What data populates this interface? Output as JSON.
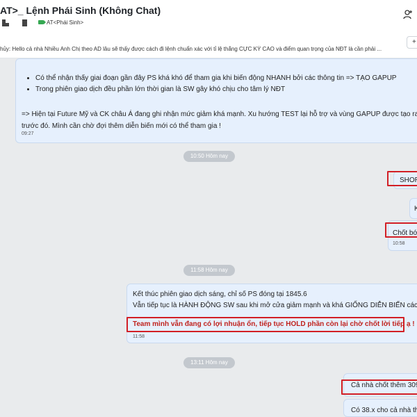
{
  "header": {
    "title": "AT>_ Lệnh Phái Sinh (Không Chat)",
    "tag": "AT<Phái Sinh>"
  },
  "pinned": {
    "text": "hủy: Hello cả nhà Nhiều Anh Chị theo AD lâu sẽ thấy được cách đi lệnh chuẩn xác với tỉ lệ thắng CỰC KỲ CAO và điểm quan trọng của NĐT là cần phải ...",
    "button": "+"
  },
  "messages": {
    "m1": {
      "bullets": [
        "Có thể nhận thấy giai đoạn gần đây PS khá khó để tham gia khi biến động NHANH bởi các thông tin => TẠO GAPUP",
        "Trong phiên giao dịch đều phần lớn thời gian là SW gây khó chịu cho tâm lý NĐT"
      ],
      "line1": "=> Hiện tại Future Mỹ và CK châu Á đang ghi nhận mức giảm khá mạnh. Xu hướng TEST lại hỗ trợ và vùng GAPUP được tạo ra t",
      "line2": "trước đó. Mình cần chờ đợi thêm diễn biến mới có thể tham gia !",
      "time": "09:27"
    },
    "sep1": "10:50 Hôm nay",
    "m2": {
      "text": "SHOR"
    },
    "m3": {
      "text": "K"
    },
    "m4": {
      "text": "Chốt bớ",
      "time": "10:58"
    },
    "sep2": "11:58 Hôm nay",
    "m5": {
      "line1": "Kết thúc phiên giao dịch sáng, chỉ số PS đóng tại 1845.6",
      "line2": "Vẫn tiếp tục là HÀNH ĐỘNG SW sau khi mở cửa giảm mạnh và khá GIỐNG DIỄN BIẾN các p",
      "line3": "Team mình vẫn đang có lợi nhuận ổn, tiếp tục HOLD phần còn lại chờ chốt lời tiếp ạ !",
      "time": "11:58"
    },
    "sep3": "13:11 Hôm nay",
    "m6": {
      "text": "Cả nhà chốt thêm 309"
    },
    "m7": {
      "text": "Có 38.x cho cả nhà tho"
    }
  },
  "colors": {
    "bubble": "#e6f0fd",
    "highlight": "#d21f26",
    "chat_bg": "#e9ebed"
  }
}
